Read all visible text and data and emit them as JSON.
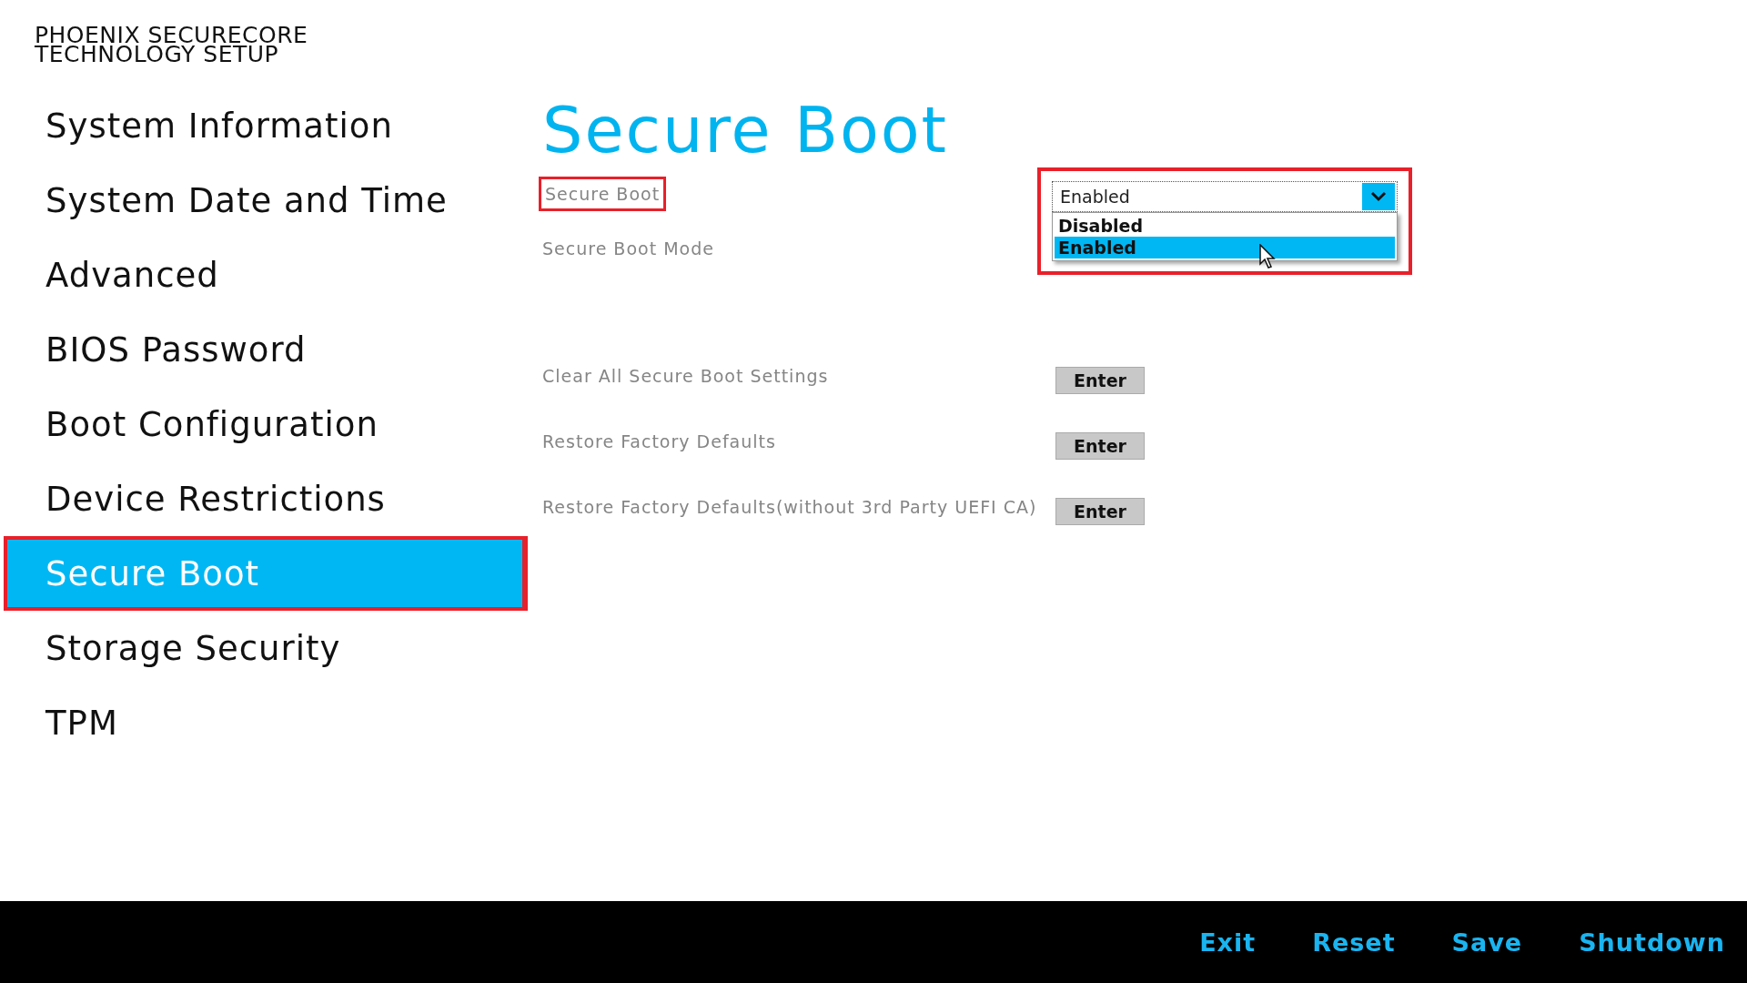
{
  "header": {
    "title_lines": [
      "PHOENIX SECURECORE",
      "TECHNOLOGY SETUP"
    ]
  },
  "sidebar": {
    "items": [
      {
        "label": "System Information",
        "selected": false,
        "highlighted": false
      },
      {
        "label": "System Date and Time",
        "selected": false,
        "highlighted": false
      },
      {
        "label": "Advanced",
        "selected": false,
        "highlighted": false
      },
      {
        "label": "BIOS Password",
        "selected": false,
        "highlighted": false
      },
      {
        "label": "Boot Configuration",
        "selected": false,
        "highlighted": false
      },
      {
        "label": "Device Restrictions",
        "selected": false,
        "highlighted": false
      },
      {
        "label": "Secure Boot",
        "selected": true,
        "highlighted": true
      },
      {
        "label": "Storage Security",
        "selected": false,
        "highlighted": false
      },
      {
        "label": "TPM",
        "selected": false,
        "highlighted": false
      }
    ]
  },
  "page": {
    "title": "Secure Boot"
  },
  "settings": [
    {
      "kind": "dropdown",
      "label": "Secure Boot",
      "highlighted": true,
      "value": "Enabled",
      "expanded": true,
      "options": [
        {
          "label": "Disabled",
          "selected": false
        },
        {
          "label": "Enabled",
          "selected": true
        }
      ]
    },
    {
      "kind": "info",
      "label": "Secure Boot Mode"
    },
    {
      "kind": "action",
      "label": "Clear All Secure Boot Settings",
      "button": "Enter"
    },
    {
      "kind": "action",
      "label": "Restore Factory Defaults",
      "button": "Enter"
    },
    {
      "kind": "action",
      "label": "Restore Factory Defaults(without 3rd Party UEFI CA)",
      "button": "Enter"
    }
  ],
  "footer": {
    "buttons": [
      "Exit",
      "Reset",
      "Save",
      "Shutdown"
    ]
  }
}
